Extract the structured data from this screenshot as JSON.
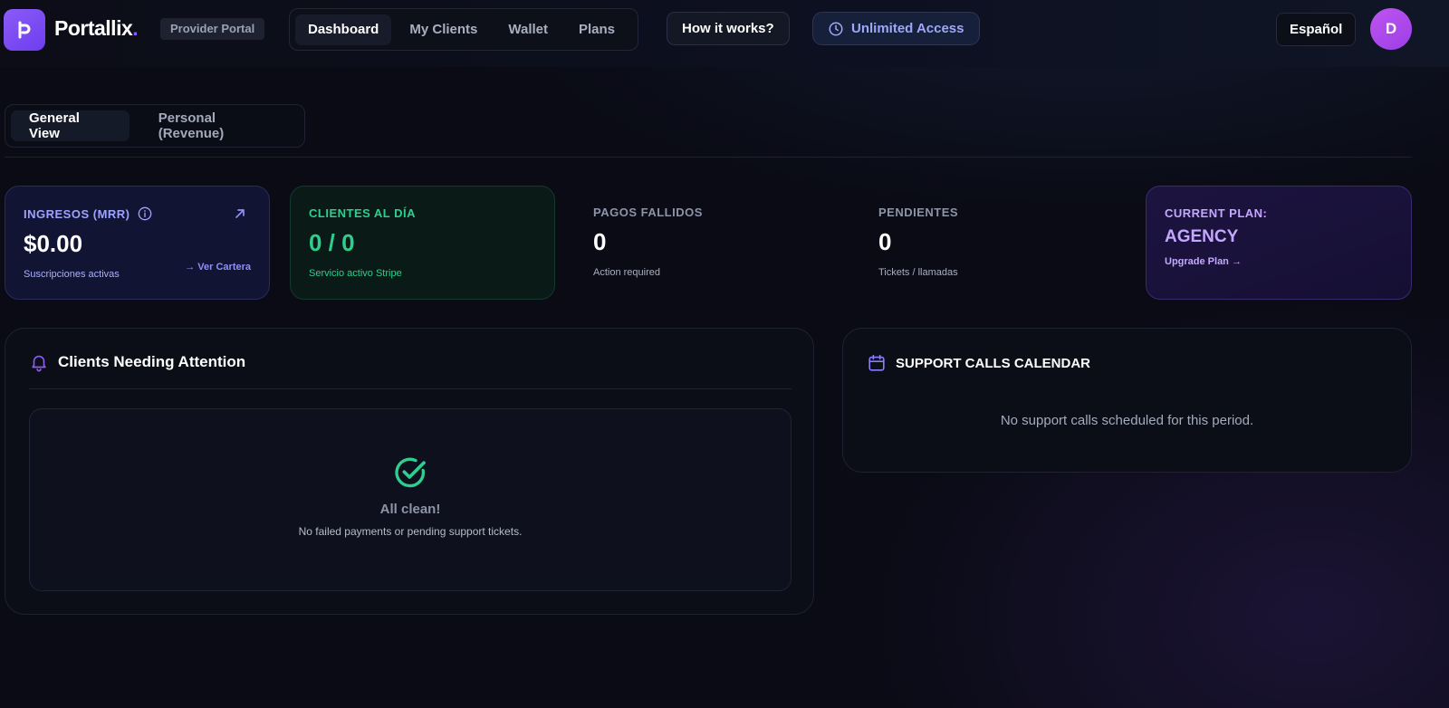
{
  "brand": {
    "name": "Portallix",
    "dot": ".",
    "badge": "Provider Portal"
  },
  "nav": {
    "items": [
      {
        "label": "Dashboard",
        "active": true
      },
      {
        "label": "My Clients",
        "active": false
      },
      {
        "label": "Wallet",
        "active": false
      },
      {
        "label": "Plans",
        "active": false
      }
    ],
    "how_it_works": "How it works?",
    "unlimited": "Unlimited Access",
    "language": "Español",
    "avatar_initial": "D"
  },
  "view_toggle": {
    "general": "General View",
    "personal": "Personal (Revenue)"
  },
  "stats": {
    "mrr": {
      "label": "INGRESOS (MRR)",
      "value": "$0.00",
      "sub": "Suscripciones activas",
      "link": "→ Ver Cartera"
    },
    "clientes": {
      "label": "CLIENTES AL DÍA",
      "value": "0 / 0",
      "sub": "Servicio activo Stripe"
    },
    "pagos": {
      "label": "PAGOS FALLIDOS",
      "value": "0",
      "sub": "Action required"
    },
    "pendientes": {
      "label": "PENDIENTES",
      "value": "0",
      "sub": "Tickets / llamadas"
    },
    "plan": {
      "label": "CURRENT PLAN:",
      "value": "AGENCY",
      "link": "Upgrade Plan →"
    }
  },
  "attention": {
    "title": "Clients Needing Attention",
    "empty_title": "All clean!",
    "empty_sub": "No failed payments or pending support tickets."
  },
  "calendar": {
    "title": "SUPPORT CALLS CALENDAR",
    "empty": "No support calls scheduled for this period."
  },
  "colors": {
    "accent": "#8b5cf6",
    "green": "#2ecf8e",
    "mrr_label": "#9ea3ff",
    "plan_text": "#c4a8ff"
  }
}
